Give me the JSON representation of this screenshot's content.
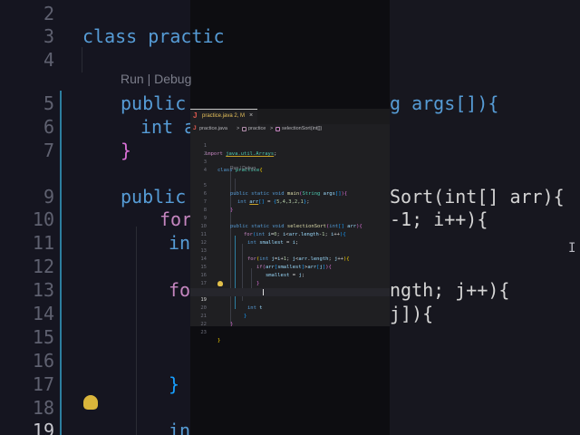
{
  "background": {
    "line_numbers": [
      "2",
      "3",
      "4",
      "5",
      "6",
      "7",
      "9",
      "10",
      "11",
      "12",
      "13",
      "14",
      "15",
      "16",
      "17",
      "18",
      "19"
    ],
    "code_lines": [
      {
        "line": "3",
        "text": "class practic"
      },
      {
        "line": "5",
        "text": "public "
      },
      {
        "line": "5b",
        "text": "g args[]){"
      },
      {
        "line": "6",
        "text": "int a"
      },
      {
        "line": "7",
        "text": "}"
      },
      {
        "line": "9",
        "text": "public "
      },
      {
        "line": "9b",
        "text": "Sort(int[] arr){"
      },
      {
        "line": "10",
        "text": "for("
      },
      {
        "line": "10b",
        "text": "-1; i++){"
      },
      {
        "line": "11",
        "text": "in"
      },
      {
        "line": "14",
        "text": "for"
      },
      {
        "line": "14b",
        "text": "ngth; j++){"
      },
      {
        "line": "15",
        "text": "j]){"
      },
      {
        "line": "17",
        "text": "}"
      },
      {
        "line": "19",
        "text": "in"
      }
    ],
    "codelens": "Run | Debug"
  },
  "editor": {
    "tab": {
      "icon_letter": "J",
      "filename": "practice.java",
      "status": "2, M",
      "close": "×"
    },
    "breadcrumb": {
      "file": "practice.java",
      "class": "practice",
      "method": "selectionSort(int[])",
      "sep": ">"
    },
    "codelens": "Run | Debug",
    "lines": [
      {
        "n": "1",
        "code": "import java.util.Arrays;"
      },
      {
        "n": "2",
        "code": ""
      },
      {
        "n": "3",
        "code": "class practice{"
      },
      {
        "n": "4",
        "code": ""
      },
      {
        "n": "5",
        "code": "public static void main(String args[]){"
      },
      {
        "n": "6",
        "code": "int arr[] = {5,4,3,2,1};"
      },
      {
        "n": "7",
        "code": "}"
      },
      {
        "n": "8",
        "code": ""
      },
      {
        "n": "9",
        "code": "public static void selectionSort(int[] arr){"
      },
      {
        "n": "10",
        "code": "for(int i=0; i<arr.length-1; i++){"
      },
      {
        "n": "11",
        "code": "int smallest = i;"
      },
      {
        "n": "12",
        "code": ""
      },
      {
        "n": "13",
        "code": "for(int j=i+1; j<arr.length; j++){"
      },
      {
        "n": "14",
        "code": "if(arr[smallest]>arr[j]){"
      },
      {
        "n": "15",
        "code": "smallest = j;"
      },
      {
        "n": "16",
        "code": "}"
      },
      {
        "n": "17",
        "code": "}"
      },
      {
        "n": "18",
        "code": ""
      },
      {
        "n": "19",
        "code": "int t"
      },
      {
        "n": "20",
        "code": "}"
      },
      {
        "n": "21",
        "code": "}"
      },
      {
        "n": "22",
        "code": ""
      },
      {
        "n": "23",
        "code": "}"
      }
    ],
    "current_line": "19"
  },
  "colors": {
    "keyword": "#569cd6",
    "type": "#4ec9b0",
    "function": "#dcdcaa",
    "variable": "#9cdcfe",
    "number": "#b5cea8",
    "tab_modified": "#e8c25b"
  }
}
